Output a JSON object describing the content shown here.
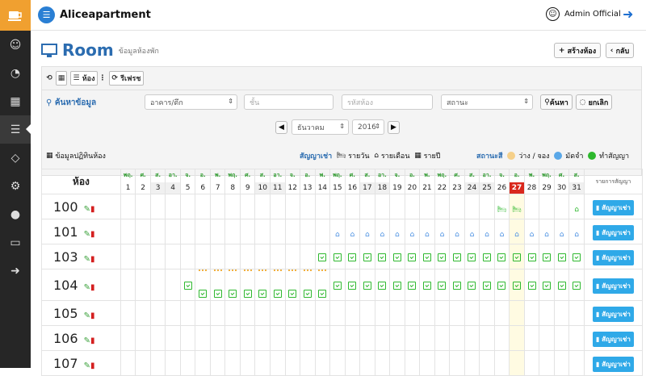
{
  "app": {
    "title": "Aliceapartment",
    "user": "Admin Official"
  },
  "sidebar": {
    "icons": [
      "smile-icon",
      "dashboard-icon",
      "calendar-icon",
      "list-icon",
      "diamond-icon",
      "gears-icon",
      "user-icon",
      "laptop-icon",
      "sign-out-icon"
    ]
  },
  "page": {
    "title": "Room",
    "subtitle": "ข้อมูลห้องพัก",
    "create_label": "สร้างห้อง",
    "back_label": "กลับ"
  },
  "toolbar": {
    "room_label": "ห้อง",
    "refresh_label": "รีเฟรช"
  },
  "search": {
    "label": "ค้นหาข้อมูล",
    "building": "อาคาร/ตึก",
    "floor_ph": "ชั้น",
    "code_ph": "รหัสห้อง",
    "status": "สถานะ",
    "search_btn": "ค้นหา",
    "cancel_btn": "ยกเลิก",
    "month": "ธันวาคม",
    "year": "2016"
  },
  "legend": {
    "calendar_label": "ข้อมูลปฏิทินห้อง",
    "contract_label": "สัญญาเช่า",
    "daily": "รายวัน",
    "monthly": "รายเดือน",
    "yearly": "รายปี",
    "color_label": "สถานะสี",
    "free": "ว่าง / จอง",
    "deposit": "มัดจำ",
    "contract": "ทำสัญญา"
  },
  "colors": {
    "free": "#f5d08a",
    "deposit": "#5aa8e8",
    "contract": "#2db82d",
    "today": "#d9281c"
  },
  "grid": {
    "room_header": "ห้อง",
    "list_header": "รายการสัญญา",
    "contract_btn": "สัญญาเช่า",
    "today": 27,
    "dow": [
      "พฤ.",
      "ศ.",
      "ส.",
      "อา.",
      "จ.",
      "อ.",
      "พ.",
      "พฤ.",
      "ศ.",
      "ส.",
      "อา.",
      "จ.",
      "อ.",
      "พ.",
      "พฤ.",
      "ศ.",
      "ส.",
      "อา.",
      "จ.",
      "อ.",
      "พ.",
      "พฤ.",
      "ศ.",
      "ส.",
      "อา.",
      "จ.",
      "อ.",
      "พ.",
      "พฤ.",
      "ศ.",
      "ส."
    ],
    "rooms": [
      {
        "no": "100"
      },
      {
        "no": "101"
      },
      {
        "no": "103"
      },
      {
        "no": "104"
      },
      {
        "no": "105"
      },
      {
        "no": "106"
      },
      {
        "no": "107"
      }
    ]
  }
}
